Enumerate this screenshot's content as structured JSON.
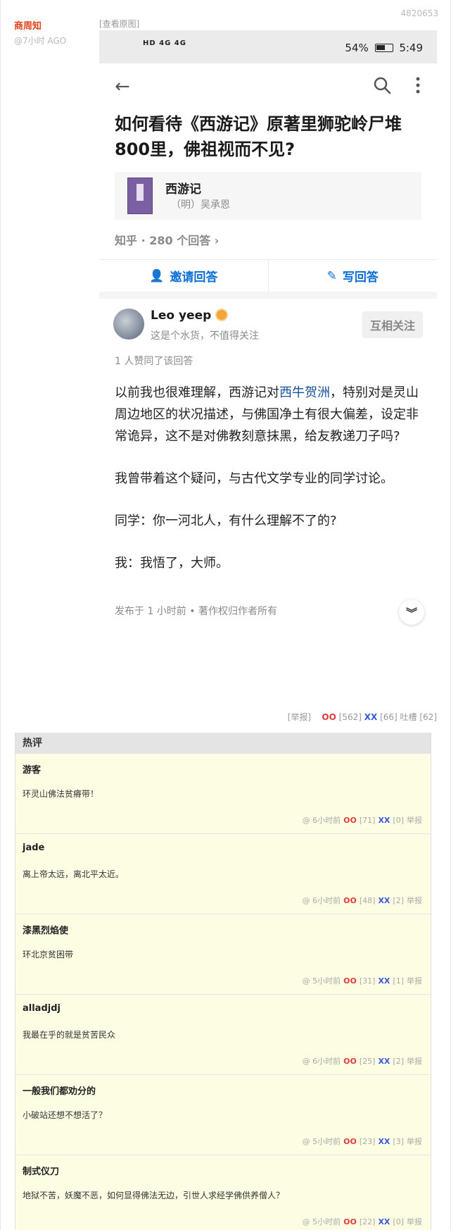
{
  "post": {
    "author": "商周知",
    "time": "@7小时 AGO",
    "id": "4820653",
    "view_original": "[查看原图]"
  },
  "screenshot": {
    "status": {
      "network": "HD 4G 4G",
      "battery": "54%",
      "clock": "5:49"
    },
    "question_title": "如何看待《西游记》原著里狮驼岭尸堆800里，佛祖视而不见?",
    "book": {
      "title": "西游记",
      "author": "（明）吴承恩"
    },
    "meta": "知乎 · 280 个回答 ›",
    "actions": {
      "invite": "邀请回答",
      "write": "写回答"
    },
    "answerer": {
      "name": "Leo yeep",
      "bio": "这是个水货，不值得关注",
      "follow": "互相关注"
    },
    "likes": "1 人赞同了该回答",
    "paragraphs": {
      "p1_a": "以前我也很难理解，西游记对",
      "p1_link": "西牛贺洲",
      "p1_b": "，特别对是灵山周边地区的状况描述，与佛国净土有很大偏差，设定非常诡异，这不是对佛教刻意抹黑，给友教递刀子吗?",
      "p2": "我曾带着这个疑问，与古代文学专业的同学讨论。",
      "p3": "同学：你一河北人，有什么理解不了的?",
      "p4": "我：我悟了，大师。"
    },
    "published": "发布于 1 小时前 • 著作权归作者所有",
    "collapse_icon": "double-chevron-down"
  },
  "post_footer": {
    "report": "[举报]",
    "oo_label": "OO",
    "oo_count": "[562]",
    "xx_label": "XX",
    "xx_count": "[66]",
    "tucao": "吐槽 [62]"
  },
  "hot_comments": {
    "header": "热评",
    "items": [
      {
        "author": "游客",
        "text": "环灵山佛法贫瘠带！",
        "time": "@ 6小时前",
        "oo": "[71]",
        "xx": "[0]",
        "report": "举报"
      },
      {
        "author": "jade",
        "text": "离上帝太远，离北平太近。",
        "time": "@ 6小时前",
        "oo": "[48]",
        "xx": "[2]",
        "report": "举报"
      },
      {
        "author": "漆黑烈焰使",
        "text": "环北京贫困带",
        "time": "@ 5小时前",
        "oo": "[31]",
        "xx": "[1]",
        "report": "举报"
      },
      {
        "author": "alladjdj",
        "text": "我最在乎的就是贫苦民众",
        "time": "@ 6小时前",
        "oo": "[25]",
        "xx": "[2]",
        "report": "举报"
      },
      {
        "author": "一般我们都劝分的",
        "text": "小破站还想不想活了？",
        "time": "@ 5小时前",
        "oo": "[23]",
        "xx": "[3]",
        "report": "举报"
      },
      {
        "author": "制式仪刀",
        "text": "地狱不苦，妖魔不恶，如何显得佛法无边，引世人求经学佛供养僧人？",
        "time": "@ 5小时前",
        "oo": "[22]",
        "xx": "[0]",
        "report": "举报"
      }
    ]
  }
}
